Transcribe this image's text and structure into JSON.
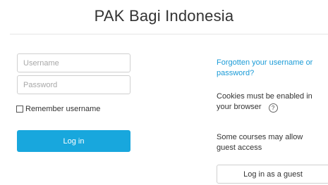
{
  "site": {
    "title": "PAK Bagi Indonesia"
  },
  "login_form": {
    "username_placeholder": "Username",
    "password_placeholder": "Password",
    "remember_label": "Remember username",
    "remember_checked": false,
    "login_button": "Log in"
  },
  "side_info": {
    "forgot_line1": "Forgotten your username or",
    "forgot_line2": "password?",
    "cookies_line1": "Cookies must be enabled in",
    "cookies_line2": "your browser",
    "help_icon": "question-circle-icon",
    "help_glyph": "?",
    "guest_line1": "Some courses may allow",
    "guest_line2": "guest access",
    "guest_button": "Log in as a guest"
  },
  "colors": {
    "primary_button": "#18a7dd",
    "link": "#1a9bd7"
  }
}
